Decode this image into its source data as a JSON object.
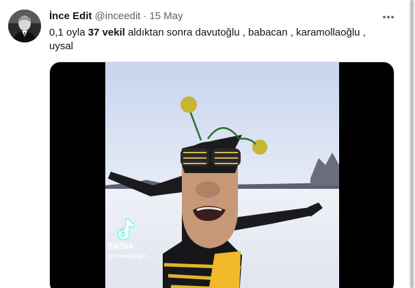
{
  "tweet": {
    "display_name": "İnce Edit",
    "handle": "@inceedit",
    "separator": "·",
    "date": "15 May",
    "text_before": "0,1 oyla ",
    "text_bold": "37 vekil",
    "text_after": " aldıktan sonra davutoğlu , babacan , karamollaoğlu , uysal"
  },
  "media": {
    "watermark_brand": "TikTok",
    "watermark_user": "@chendong7c"
  },
  "icons": {
    "avatar": "avatar-photo",
    "more": "more-horizontal-icon",
    "tiktok": "tiktok-logo-icon"
  }
}
